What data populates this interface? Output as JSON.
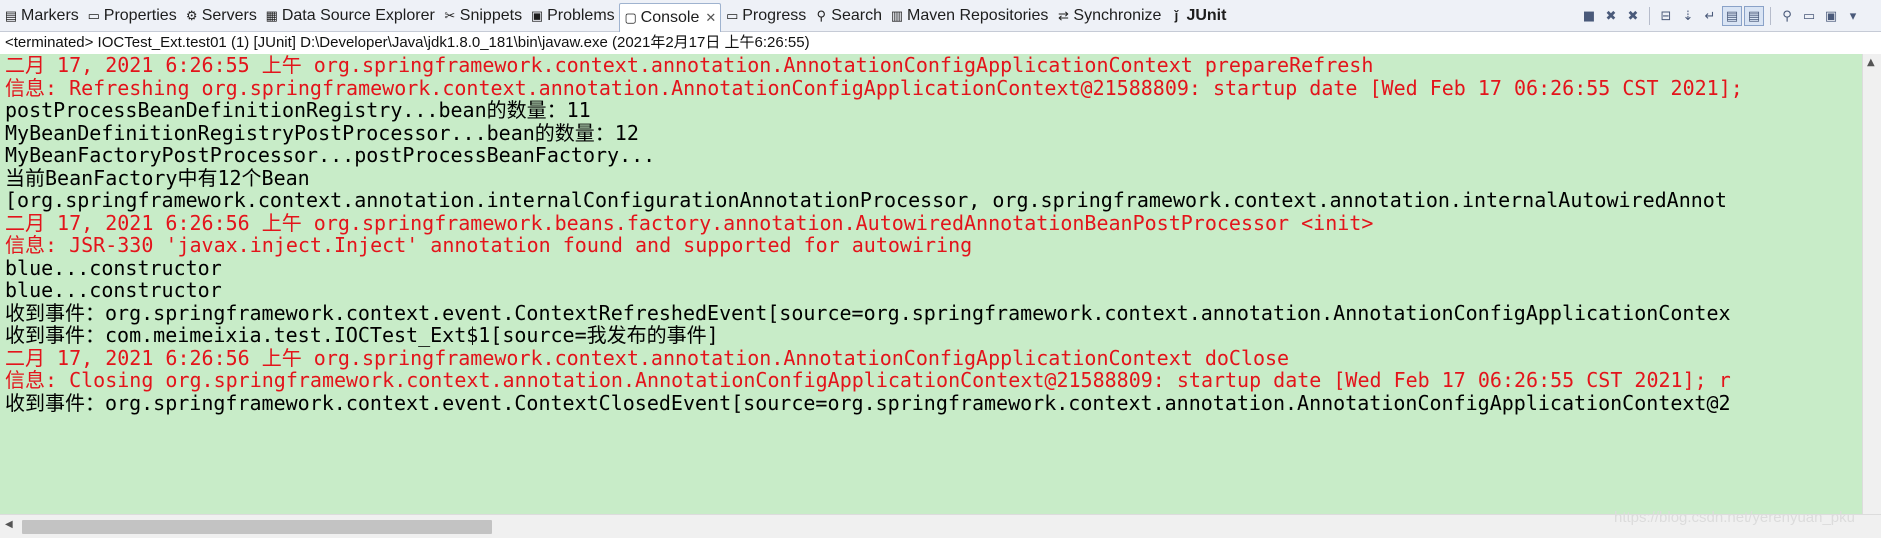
{
  "tabs": [
    {
      "label": "Markers",
      "icon": "markers-icon",
      "glyph": "▤"
    },
    {
      "label": "Properties",
      "icon": "properties-icon",
      "glyph": "▭"
    },
    {
      "label": "Servers",
      "icon": "servers-icon",
      "glyph": "⚙"
    },
    {
      "label": "Data Source Explorer",
      "icon": "data-source-icon",
      "glyph": "▦"
    },
    {
      "label": "Snippets",
      "icon": "snippets-icon",
      "glyph": "✂"
    },
    {
      "label": "Problems",
      "icon": "problems-icon",
      "glyph": "▣"
    },
    {
      "label": "Console",
      "icon": "console-icon",
      "glyph": "▢",
      "active": true,
      "close": "✕"
    },
    {
      "label": "Progress",
      "icon": "progress-icon",
      "glyph": "▭"
    },
    {
      "label": "Search",
      "icon": "search-icon",
      "glyph": "⚲"
    },
    {
      "label": "Maven Repositories",
      "icon": "maven-icon",
      "glyph": "▥"
    },
    {
      "label": "Synchronize",
      "icon": "synchronize-icon",
      "glyph": "⇄"
    },
    {
      "label": "JUnit",
      "icon": "junit-icon",
      "glyph": "ǰ",
      "bold": true
    }
  ],
  "toolbar": [
    "stop-icon",
    "remove-launch-icon",
    "remove-all-icon",
    "sep",
    "clear-console-icon",
    "scroll-lock-icon",
    "word-wrap-icon",
    "show-on-stdout-icon",
    "show-on-stderr-icon",
    "sep",
    "pin-console-icon",
    "display-console-icon",
    "open-console-icon",
    "view-menu-icon"
  ],
  "status": "<terminated> IOCTest_Ext.test01 (1) [JUnit] D:\\Developer\\Java\\jdk1.8.0_181\\bin\\javaw.exe (2021年2月17日 上午6:26:55)",
  "console_lines": [
    {
      "text": "二月 17, 2021 6:26:55 上午 org.springframework.context.annotation.AnnotationConfigApplicationContext prepareRefresh",
      "err": true
    },
    {
      "text": "信息: Refreshing org.springframework.context.annotation.AnnotationConfigApplicationContext@21588809: startup date [Wed Feb 17 06:26:55 CST 2021];",
      "err": true
    },
    {
      "text": "postProcessBeanDefinitionRegistry...bean的数量：11",
      "err": false
    },
    {
      "text": "MyBeanDefinitionRegistryPostProcessor...bean的数量：12",
      "err": false
    },
    {
      "text": "MyBeanFactoryPostProcessor...postProcessBeanFactory...",
      "err": false
    },
    {
      "text": "当前BeanFactory中有12个Bean",
      "err": false
    },
    {
      "text": "[org.springframework.context.annotation.internalConfigurationAnnotationProcessor, org.springframework.context.annotation.internalAutowiredAnnot",
      "err": false
    },
    {
      "text": "二月 17, 2021 6:26:56 上午 org.springframework.beans.factory.annotation.AutowiredAnnotationBeanPostProcessor <init>",
      "err": true
    },
    {
      "text": "信息: JSR-330 'javax.inject.Inject' annotation found and supported for autowiring",
      "err": true
    },
    {
      "text": "blue...constructor",
      "err": false
    },
    {
      "text": "blue...constructor",
      "err": false
    },
    {
      "text": "收到事件：org.springframework.context.event.ContextRefreshedEvent[source=org.springframework.context.annotation.AnnotationConfigApplicationContex",
      "err": false
    },
    {
      "text": "收到事件：com.meimeixia.test.IOCTest_Ext$1[source=我发布的事件]",
      "err": false
    },
    {
      "text": "二月 17, 2021 6:26:56 上午 org.springframework.context.annotation.AnnotationConfigApplicationContext doClose",
      "err": true
    },
    {
      "text": "信息: Closing org.springframework.context.annotation.AnnotationConfigApplicationContext@21588809: startup date [Wed Feb 17 06:26:55 CST 2021]; r",
      "err": true
    },
    {
      "text": "收到事件：org.springframework.context.event.ContextClosedEvent[source=org.springframework.context.annotation.AnnotationConfigApplicationContext@2",
      "err": false
    }
  ],
  "colors": {
    "console_bg": "#c8ecc8",
    "stderr": "#e3141b",
    "stdout": "#000000"
  },
  "watermark": "https://blog.csdn.net/yerenyuan_pku"
}
